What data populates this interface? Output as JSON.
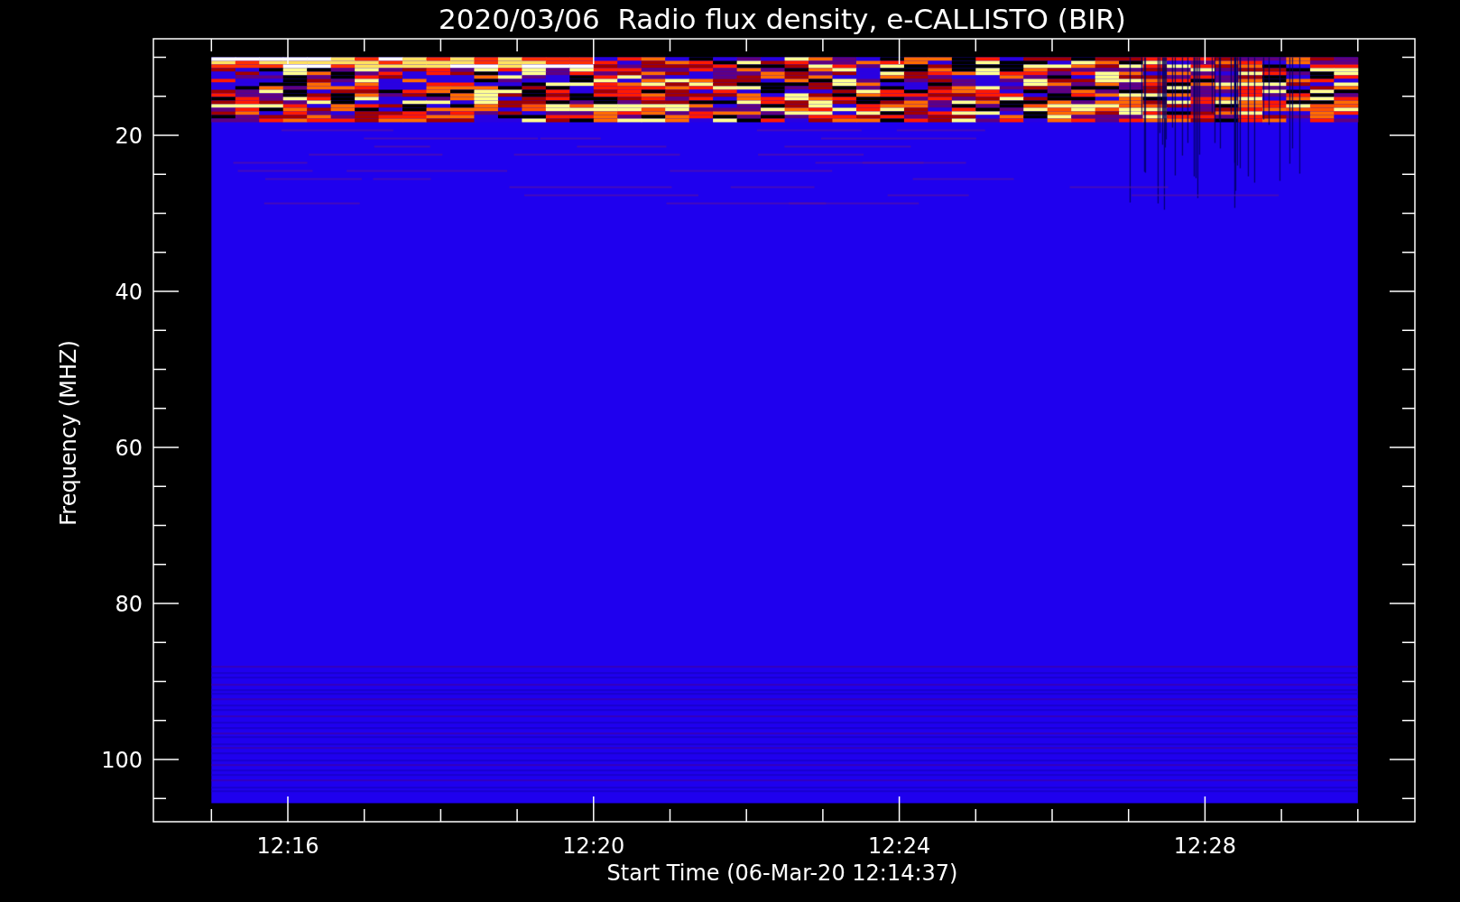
{
  "title": "2020/03/06  Radio flux density, e-CALLISTO (BIR)",
  "y_axis": {
    "label": "Frequency (MHZ)",
    "ticks": [
      "20",
      "40",
      "60",
      "80",
      "100"
    ]
  },
  "x_axis": {
    "label": "Start Time (06-Mar-20 12:14:37)",
    "ticks": [
      "12:16",
      "12:20",
      "12:24",
      "12:28"
    ]
  }
}
